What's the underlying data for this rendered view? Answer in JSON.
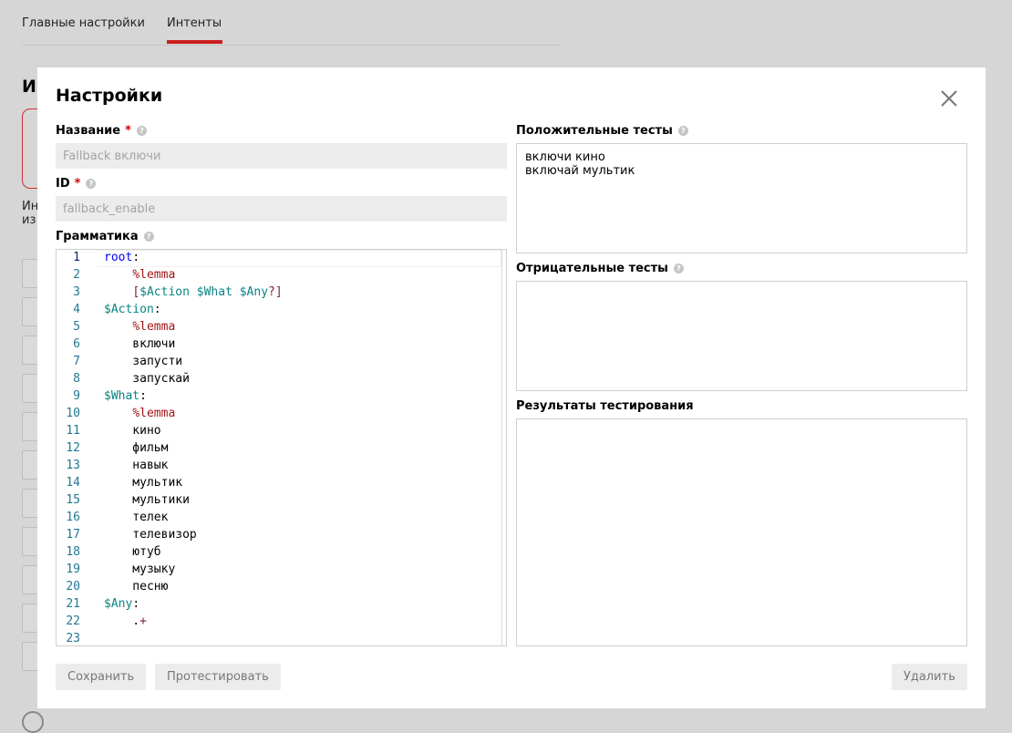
{
  "background": {
    "tabs": [
      {
        "label": "Главные настройки"
      },
      {
        "label": "Интенты"
      }
    ],
    "heading": "Ин",
    "text_line1": "Ин",
    "text_line2": "из"
  },
  "modal": {
    "title": "Настройки",
    "name_field": {
      "label": "Название",
      "required": "*",
      "placeholder": "Fallback включи"
    },
    "id_field": {
      "label": "ID",
      "required": "*",
      "placeholder": "fallback_enable"
    },
    "grammar_label": "Грамматика",
    "help_glyph": "?",
    "grammar_lines": [
      "root:",
      "    %lemma",
      "    [$Action $What $Any?]",
      "$Action:",
      "    %lemma",
      "    включи",
      "    запусти",
      "    запускай",
      "$What:",
      "    %lemma",
      "    кино",
      "    фильм",
      "    навык",
      "    мультик",
      "    мультики",
      "    телек",
      "    телевизор",
      "    ютуб",
      "    музыку",
      "    песню",
      "$Any:",
      "    .+",
      ""
    ],
    "positive_tests": {
      "label": "Положительные тесты",
      "value": "включи кино\nвключай мультик"
    },
    "negative_tests": {
      "label": "Отрицательные тесты",
      "value": ""
    },
    "test_results": {
      "label": "Результаты тестирования",
      "value": ""
    },
    "buttons": {
      "save": "Сохранить",
      "test": "Протестировать",
      "delete": "Удалить"
    }
  },
  "colors": {
    "accent": "#cc1f1f",
    "required": "#d40000",
    "keyword": "#0000ff",
    "variable": "#098484",
    "directive": "#a31515"
  },
  "icons": {
    "close": "close-icon",
    "help": "help-icon"
  }
}
